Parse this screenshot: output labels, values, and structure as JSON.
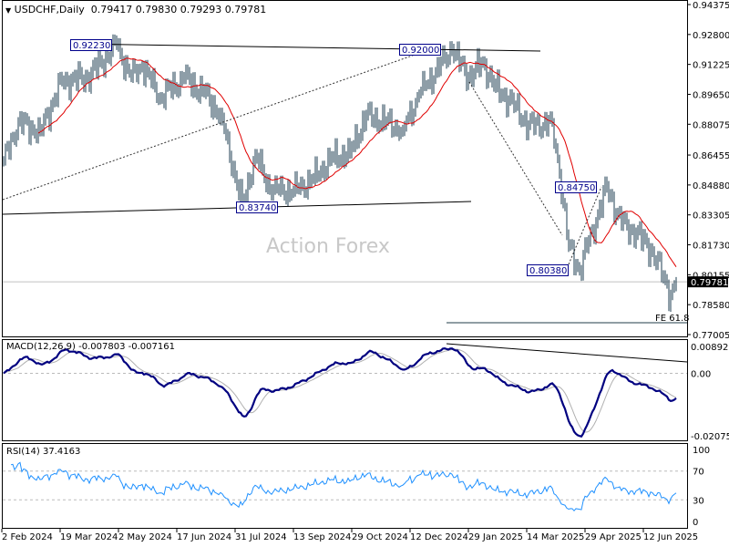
{
  "header": {
    "symbol": "USDCHF,Daily",
    "ohlc": "0.79417 0.79830 0.79293 0.79781"
  },
  "watermark": "Action Forex",
  "chart_data": [
    {
      "type": "ohlc",
      "title": "USDCHF,Daily",
      "ylim": [
        0.77005,
        0.94375
      ],
      "yticks": [
        "0.94375",
        "0.92800",
        "0.91225",
        "0.89650",
        "0.88075",
        "0.86455",
        "0.84880",
        "0.83305",
        "0.81730",
        "0.80155",
        "0.78580",
        "0.77005"
      ],
      "current_price": "0.79781",
      "xticks": [
        "2 Feb 2024",
        "19 Mar 2024",
        "2 May 2024",
        "17 Jun 2024",
        "31 Jul 2024",
        "13 Sep 2024",
        "29 Oct 2024",
        "12 Dec 2024",
        "29 Jan 2025",
        "14 Mar 2025",
        "29 Apr 2025",
        "12 Jun 2025"
      ],
      "price_path": [
        [
          "2024-02-02",
          0.862
        ],
        [
          "2024-02-14",
          0.882
        ],
        [
          "2024-03-01",
          0.877
        ],
        [
          "2024-03-19",
          0.903
        ],
        [
          "2024-04-08",
          0.905
        ],
        [
          "2024-04-30",
          0.9223
        ],
        [
          "2024-05-10",
          0.906
        ],
        [
          "2024-05-20",
          0.912
        ],
        [
          "2024-06-03",
          0.895
        ],
        [
          "2024-06-20",
          0.905
        ],
        [
          "2024-07-05",
          0.897
        ],
        [
          "2024-07-18",
          0.886
        ],
        [
          "2024-08-05",
          0.8374
        ],
        [
          "2024-08-14",
          0.865
        ],
        [
          "2024-08-26",
          0.847
        ],
        [
          "2024-09-12",
          0.846
        ],
        [
          "2024-09-27",
          0.852
        ],
        [
          "2024-10-10",
          0.862
        ],
        [
          "2024-10-25",
          0.866
        ],
        [
          "2024-11-07",
          0.885
        ],
        [
          "2024-11-22",
          0.882
        ],
        [
          "2024-12-05",
          0.878
        ],
        [
          "2024-12-18",
          0.897
        ],
        [
          "2025-01-13",
          0.92
        ],
        [
          "2025-01-24",
          0.905
        ],
        [
          "2025-02-05",
          0.913
        ],
        [
          "2025-02-14",
          0.9
        ],
        [
          "2025-03-03",
          0.89
        ],
        [
          "2025-03-12",
          0.88
        ],
        [
          "2025-03-31",
          0.882
        ],
        [
          "2025-04-04",
          0.855
        ],
        [
          "2025-04-11",
          0.817
        ],
        [
          "2025-04-21",
          0.8038
        ],
        [
          "2025-04-30",
          0.825
        ],
        [
          "2025-05-12",
          0.8475
        ],
        [
          "2025-05-22",
          0.828
        ],
        [
          "2025-06-03",
          0.823
        ],
        [
          "2025-06-13",
          0.815
        ],
        [
          "2025-06-24",
          0.801
        ],
        [
          "2025-06-30",
          0.791
        ],
        [
          "2025-07-03",
          0.7978
        ]
      ],
      "moving_average": {
        "color": "#e00000"
      },
      "bar_color": "#1c3c50",
      "annotations": [
        "0.92230",
        "0.92000",
        "0.83740",
        "0.84750",
        "0.80380",
        "FE 61.8"
      ]
    },
    {
      "type": "line",
      "title": "MACD(12,26,9) -0.007803 -0.007161",
      "yticks": [
        "0.008923",
        "0.00",
        "-0.020759"
      ],
      "ylim": [
        -0.020759,
        0.008923
      ],
      "series_colors": [
        "#000080",
        "#b0b0b0"
      ]
    },
    {
      "type": "line",
      "title": "RSI(14) 37.4163",
      "yticks": [
        "100",
        "70",
        "30",
        "0"
      ],
      "ylim": [
        0,
        100
      ],
      "series_colors": [
        "#1e90ff"
      ]
    }
  ]
}
